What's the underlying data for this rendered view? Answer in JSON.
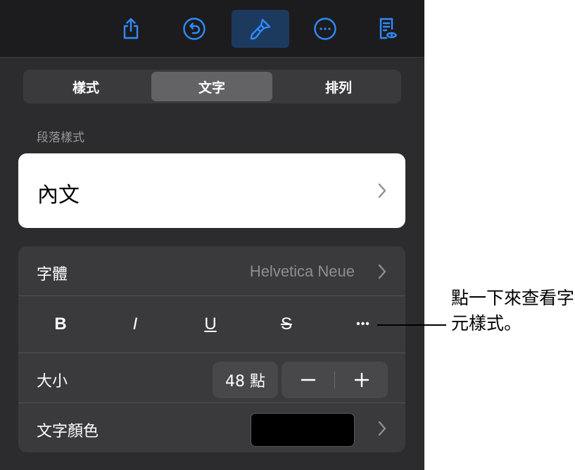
{
  "toolbar": {
    "buttons": [
      {
        "name": "share",
        "icon": "share-icon"
      },
      {
        "name": "undo",
        "icon": "undo-icon"
      },
      {
        "name": "format",
        "icon": "paintbrush-icon",
        "active": true
      },
      {
        "name": "more",
        "icon": "ellipsis-circle-icon"
      },
      {
        "name": "reading-view",
        "icon": "document-eye-icon"
      }
    ],
    "accent": "#2f8bff"
  },
  "segments": {
    "items": [
      "樣式",
      "文字",
      "排列"
    ],
    "selected": "文字"
  },
  "paragraph_style": {
    "section_label": "段落樣式",
    "value": "內文"
  },
  "font": {
    "label": "字體",
    "value": "Helvetica Neue"
  },
  "format_buttons": {
    "bold": "B",
    "italic": "I",
    "underline": "U",
    "strikethrough": "S",
    "more": "•••"
  },
  "size": {
    "label": "大小",
    "value": "48 點"
  },
  "text_color": {
    "label": "文字顏色",
    "swatch": "#000000"
  },
  "callout": {
    "text": "點一下來查看字元樣式。"
  }
}
